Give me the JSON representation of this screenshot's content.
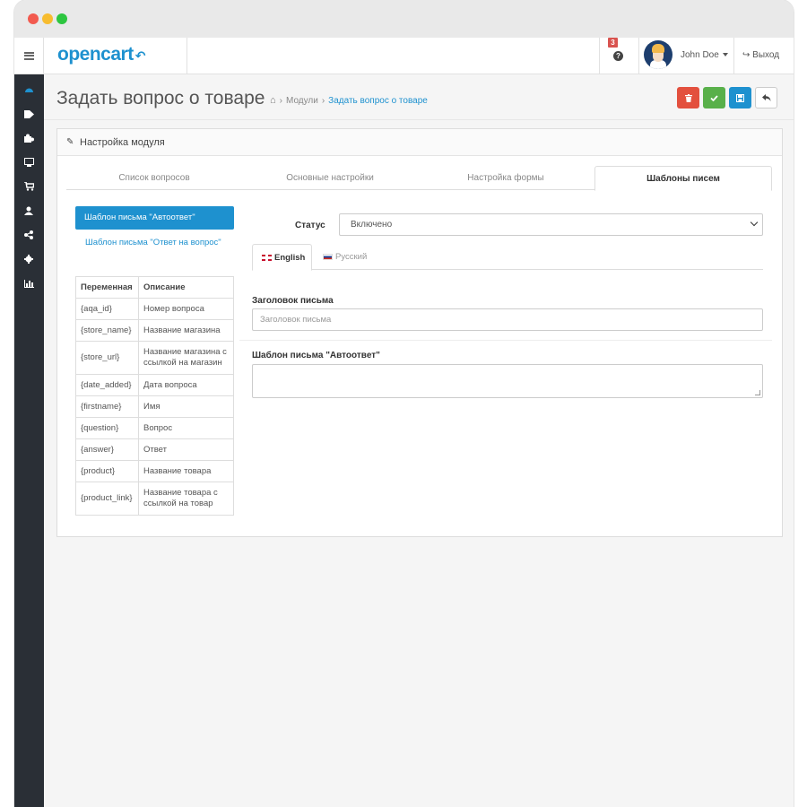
{
  "app": {
    "logo": "opencart",
    "logo_cart": "·͡7"
  },
  "header": {
    "notification_count": "3",
    "help_icon": "question-circle-icon",
    "user_name": "John Doe",
    "logout_label": "Выход"
  },
  "sidebar": {
    "icons": [
      "dashboard-icon",
      "tags-icon",
      "puzzle-icon",
      "desktop-icon",
      "cart-icon",
      "user-icon",
      "share-icon",
      "cog-icon",
      "bar-chart-icon"
    ]
  },
  "page": {
    "title": "Задать вопрос о товаре",
    "breadcrumb": {
      "home_icon": "home-icon",
      "modules": "Модули",
      "current": "Задать вопрос о товаре"
    },
    "buttons": {
      "delete": "trash-icon",
      "apply": "check-icon",
      "save": "save-icon",
      "back": "reply-icon"
    }
  },
  "panel": {
    "title": "Настройка модуля",
    "tabs": [
      "Список вопросов",
      "Основные настройки",
      "Настройка формы",
      "Шаблоны писем"
    ],
    "active_tab": "Шаблоны писем",
    "templates": {
      "autoreply": "Шаблон письма \"Автоответ\"",
      "answer": "Шаблон письма \"Ответ на вопрос\""
    },
    "variables": {
      "headers": [
        "Переменная",
        "Описание"
      ],
      "rows": [
        [
          "{aqa_id}",
          "Номер вопроса"
        ],
        [
          "{store_name}",
          "Название магазина"
        ],
        [
          "{store_url}",
          "Название магазина с ссылкой на магазин"
        ],
        [
          "{date_added}",
          "Дата вопроса"
        ],
        [
          "{firstname}",
          "Имя"
        ],
        [
          "{question}",
          "Вопрос"
        ],
        [
          "{answer}",
          "Ответ"
        ],
        [
          "{product}",
          "Название товара"
        ],
        [
          "{product_link}",
          "Название товара с ссылкой на товар"
        ]
      ]
    },
    "form": {
      "status_label": "Статус",
      "status_value": "Включено",
      "languages": [
        "English",
        "Русский"
      ],
      "subject_label": "Заголовок письма",
      "subject_placeholder": "Заголовок письма",
      "body_label": "Шаблон письма \"Автоответ\""
    }
  },
  "colors": {
    "primary": "#1e91cf",
    "danger": "#e3503e",
    "success": "#59b04a",
    "sidebar": "#2a2f36"
  }
}
